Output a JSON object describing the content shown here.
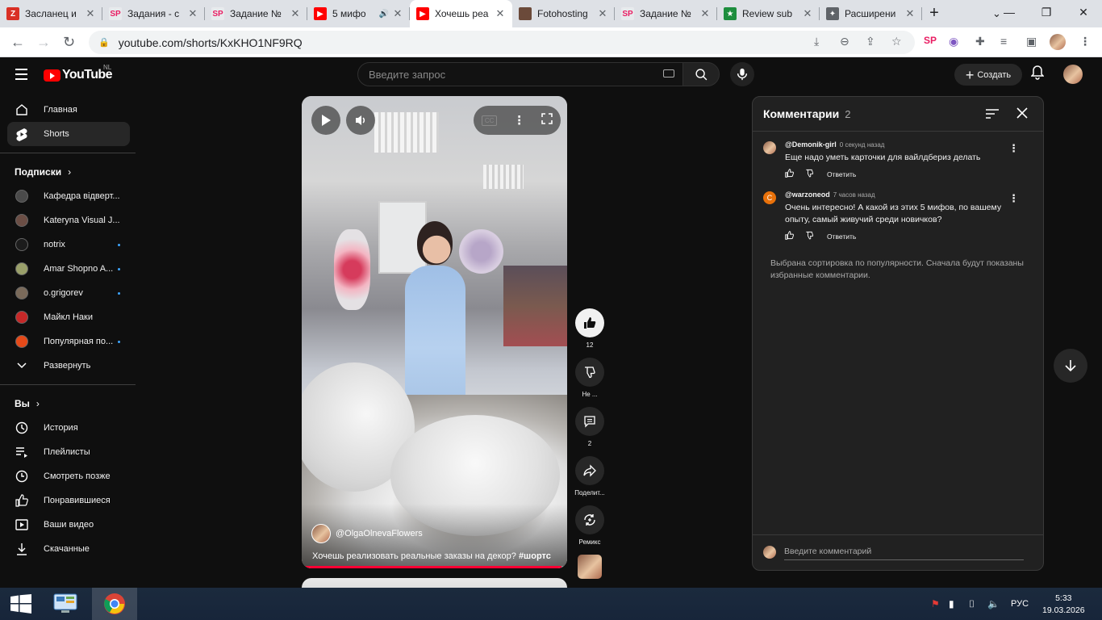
{
  "browser": {
    "tabs": [
      {
        "title": "Засланец и",
        "fav_color": "#d93025",
        "fav_text": "Z"
      },
      {
        "title": "Задания - с",
        "fav_color": "#e8eaed",
        "fav_text": "SP"
      },
      {
        "title": "Задание №",
        "fav_color": "#e8eaed",
        "fav_text": "SP"
      },
      {
        "title": "5 мифо",
        "fav_color": "#ff0000",
        "fav_text": "▶"
      },
      {
        "title": "Хочешь реа",
        "fav_color": "#ff0000",
        "fav_text": "▶",
        "active": true
      },
      {
        "title": "Fotohosting",
        "fav_color": "#6b4a3a",
        "fav_text": ""
      },
      {
        "title": "Задание №",
        "fav_color": "#e8eaed",
        "fav_text": "SP"
      },
      {
        "title": "Review sub",
        "fav_color": "#1e8e3e",
        "fav_text": "★"
      },
      {
        "title": "Расширени",
        "fav_color": "#5f6368",
        "fav_text": "✦"
      }
    ],
    "url": "youtube.com/shorts/KxKHO1NF9RQ"
  },
  "youtube": {
    "logo_text": "YouTube",
    "country_code": "NL",
    "search_placeholder": "Введите запрос",
    "create_label": "Создать",
    "sidebar": {
      "main": [
        {
          "label": "Главная",
          "icon": "home-icon"
        },
        {
          "label": "Shorts",
          "icon": "shorts-icon",
          "active": true
        }
      ],
      "subscriptions_heading": "Подписки",
      "subscriptions": [
        {
          "label": "Кафедра відверт...",
          "color": "#4a4a4a",
          "dot": false
        },
        {
          "label": "Kateryna Visual J...",
          "color": "#6b4e45",
          "dot": false
        },
        {
          "label": "notrix",
          "color": "#1c1c1c",
          "dot": true
        },
        {
          "label": "Amar Shopno A...",
          "color": "#9aa06a",
          "dot": true
        },
        {
          "label": "o.grigorev",
          "color": "#7a6a5a",
          "dot": true
        },
        {
          "label": "Майкл Наки",
          "color": "#c62828",
          "dot": false
        },
        {
          "label": "Популярная по...",
          "color": "#e64a19",
          "dot": true
        }
      ],
      "expand_label": "Развернуть",
      "you_heading": "Вы",
      "you_items": [
        {
          "label": "История",
          "icon": "history-icon"
        },
        {
          "label": "Плейлисты",
          "icon": "playlists-icon"
        },
        {
          "label": "Смотреть позже",
          "icon": "watch-later-icon"
        },
        {
          "label": "Понравившиеся",
          "icon": "liked-icon"
        },
        {
          "label": "Ваши видео",
          "icon": "your-videos-icon"
        },
        {
          "label": "Скачанные",
          "icon": "downloads-icon"
        }
      ]
    },
    "short": {
      "channel": "@OlgaOlnevaFlowers",
      "title": "Хочешь реализовать реальные заказы на декор?",
      "hashtag": "#шортс",
      "progress": 0.98,
      "likes": "12",
      "dislike_label": "Не ...",
      "comments_count": "2",
      "share_label": "Поделит...",
      "remix_label": "Ремикс",
      "cc_label": "CC"
    },
    "comments_panel": {
      "title": "Комментарии",
      "count": "2",
      "comments": [
        {
          "author": "@Demonik-girl",
          "time": "0 секунд нaзaд",
          "text": "Еще надо уметь карточки для вайлдбериз делать",
          "reply": "Ответить",
          "avatar_color": "#8a5a44",
          "avatar_letter": ""
        },
        {
          "author": "@warzoneod",
          "time": "7 часов назад",
          "text": "Очень интересно! А какой из этих 5 мифов, по вашему опыту, самый живучий среди новичков?",
          "reply": "Ответить",
          "avatar_color": "#e8710a",
          "avatar_letter": "С"
        }
      ],
      "notice": "Выбрана сортировка по популярности. Сначала будут показаны избранные комментарии.",
      "input_placeholder": "Введите комментарий"
    }
  },
  "taskbar": {
    "lang": "РУС",
    "time": "5:33",
    "date": "19.03.2026"
  }
}
